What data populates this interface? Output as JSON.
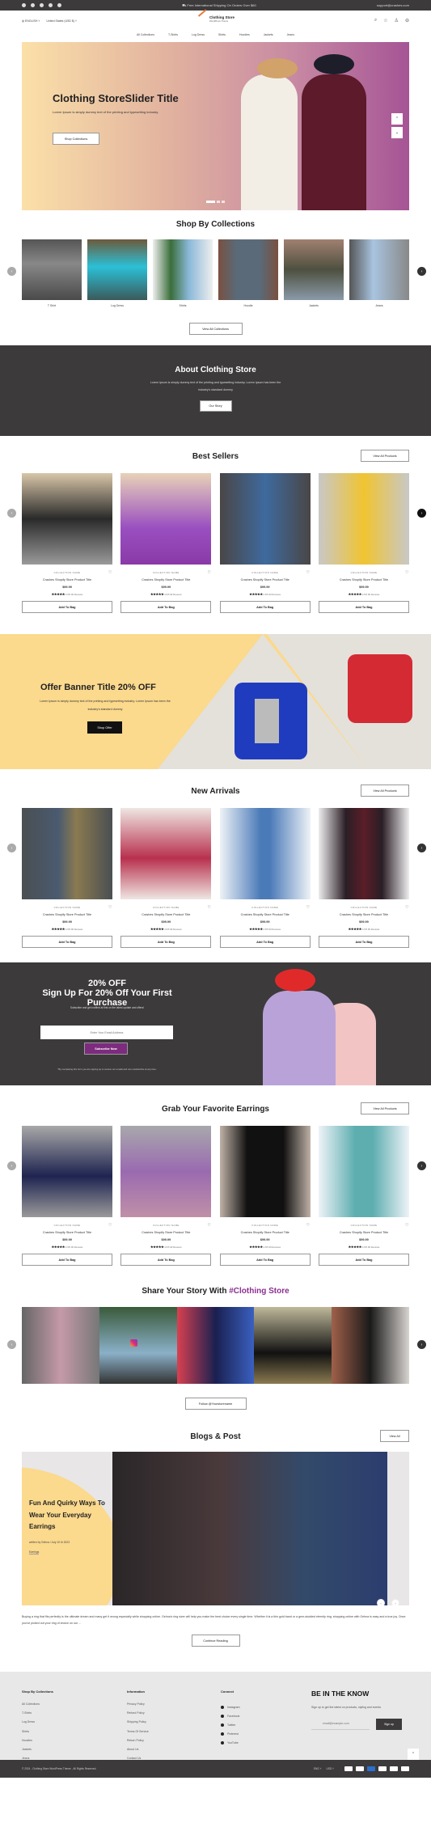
{
  "topbar": {
    "socials": [
      "facebook-icon",
      "pinterest-icon",
      "twitter-icon",
      "youtube-icon",
      "instagram-icon"
    ],
    "announcement": "⛟ Free International Shipping On Orders Over $60",
    "email": "support@crashes.com"
  },
  "header": {
    "language": "ENGLISH ˅",
    "currency": "United States (USD $) ˅",
    "logo_name": "Clothing Store",
    "logo_sub": "WordPress Theme",
    "icons": [
      "search-icon",
      "wishlist-icon",
      "account-icon",
      "cart-icon"
    ]
  },
  "nav": [
    "All Collections",
    "T-Shirts",
    "Log Dress",
    "Shirts",
    "Hoodies",
    "Jackets",
    "Jeans"
  ],
  "hero": {
    "title": "Clothing StoreSlider Title",
    "text": "Lorem Ipsum is simply dummy text of the printing and typesetting industry.",
    "button": "Shop Collections",
    "slides_total": 3,
    "active_slide": 1
  },
  "collections": {
    "title": "Shop By Collections",
    "items": [
      "T Shirt",
      "Log Dress",
      "Shirts",
      "Hoodie",
      "Jackets",
      "Jeans"
    ],
    "button": "View All Collections"
  },
  "about": {
    "title": "About Clothing Store",
    "text": "Lorem Ipsum is simply dummy text of the printing and typesetting industry. Lorem Ipsum has been the industry's standard dummy",
    "button": "Our Story"
  },
  "product_common": {
    "collection": "COLLECTION NAME",
    "title": "Crashes Shopify Store Product Title",
    "price": "$99.99",
    "stars": "★★★★★",
    "rating": "4.5/5",
    "reviews": "99 Reviews",
    "add": "Add To Bag",
    "view_all": "View All Products"
  },
  "best_sellers": {
    "title": "Best Sellers"
  },
  "offer": {
    "title": "Offer Banner Title 20% OFF",
    "text": "Lorem Ipsum is simply dummy text of the printing and typesetting industry. Lorem Ipsum has been the industry's standard dummy",
    "button": "Shop Offer"
  },
  "new_arrivals": {
    "title": "New Arrivals"
  },
  "signup": {
    "line1": "20% OFF",
    "line2": "Sign Up For 20% Off Your First Purchase",
    "sub": "Subscribe and get notified at first on the latest update and offers!",
    "placeholder": "Enter Your Email Address",
    "button": "Subscribe Now",
    "note": "*By completing this form you are signing up to receive our emails and can unsubscribe at any time."
  },
  "earrings": {
    "title": "Grab Your Favorite Earrings"
  },
  "insta": {
    "title_pre": "Share Your Story With ",
    "title_tag": "#Clothing Store",
    "button": "Follow @Yourstorename"
  },
  "blogs": {
    "title": "Blogs & Post",
    "view_all": "View All",
    "post_title": "Fun And Quirky Ways To Wear Your Everyday Earrings",
    "meta": "written by Gehna / July 10 th 2023",
    "tag": "Earrings",
    "excerpt": "Buying a ring that fits perfectly is the ultimate dream and many get it wrong especially while shopping online. Gehna's ring sizer will help you make the best choice every single time. Whether it is a thin gold band or a gem-studded eternity ring, shopping online with Gehna is easy and a true joy. Once you've picked out your ring of choice on our ...",
    "button": "Continue Reading"
  },
  "footer": {
    "col1": {
      "title": "Shop By Collections",
      "links": [
        "All Collections",
        "T-Shirts",
        "Log Dress",
        "Shirts",
        "Hoodies",
        "Jackets",
        "Jeans"
      ]
    },
    "col2": {
      "title": "Information",
      "links": [
        "Privacy Policy",
        "Refund Policy",
        "Shipping Policy",
        "Terms Of Service",
        "Return Policy",
        "About Us",
        "Contact Us"
      ]
    },
    "col3": {
      "title": "Connect",
      "links": [
        "Instagram",
        "Facebook",
        "Twitter",
        "Pinterest",
        "YouTube"
      ]
    },
    "know": {
      "title": "BE IN THE KNOW",
      "text": "Sign up to get the latest on products, styling and events",
      "placeholder": "email@example.com",
      "button": "Sign up"
    },
    "copyright": "© 2024 - Clothing Store WordPress Theme - All Rights Reserved.",
    "lang": "ENG ˅",
    "cur": "USD ˅",
    "payments": [
      "paypal",
      "visa",
      "amex",
      "diners",
      "discover",
      "mastercard"
    ]
  },
  "colors": {
    "dark": "#3c3a3b",
    "accent": "#8b2f8f",
    "yellow": "#fbd98d"
  }
}
